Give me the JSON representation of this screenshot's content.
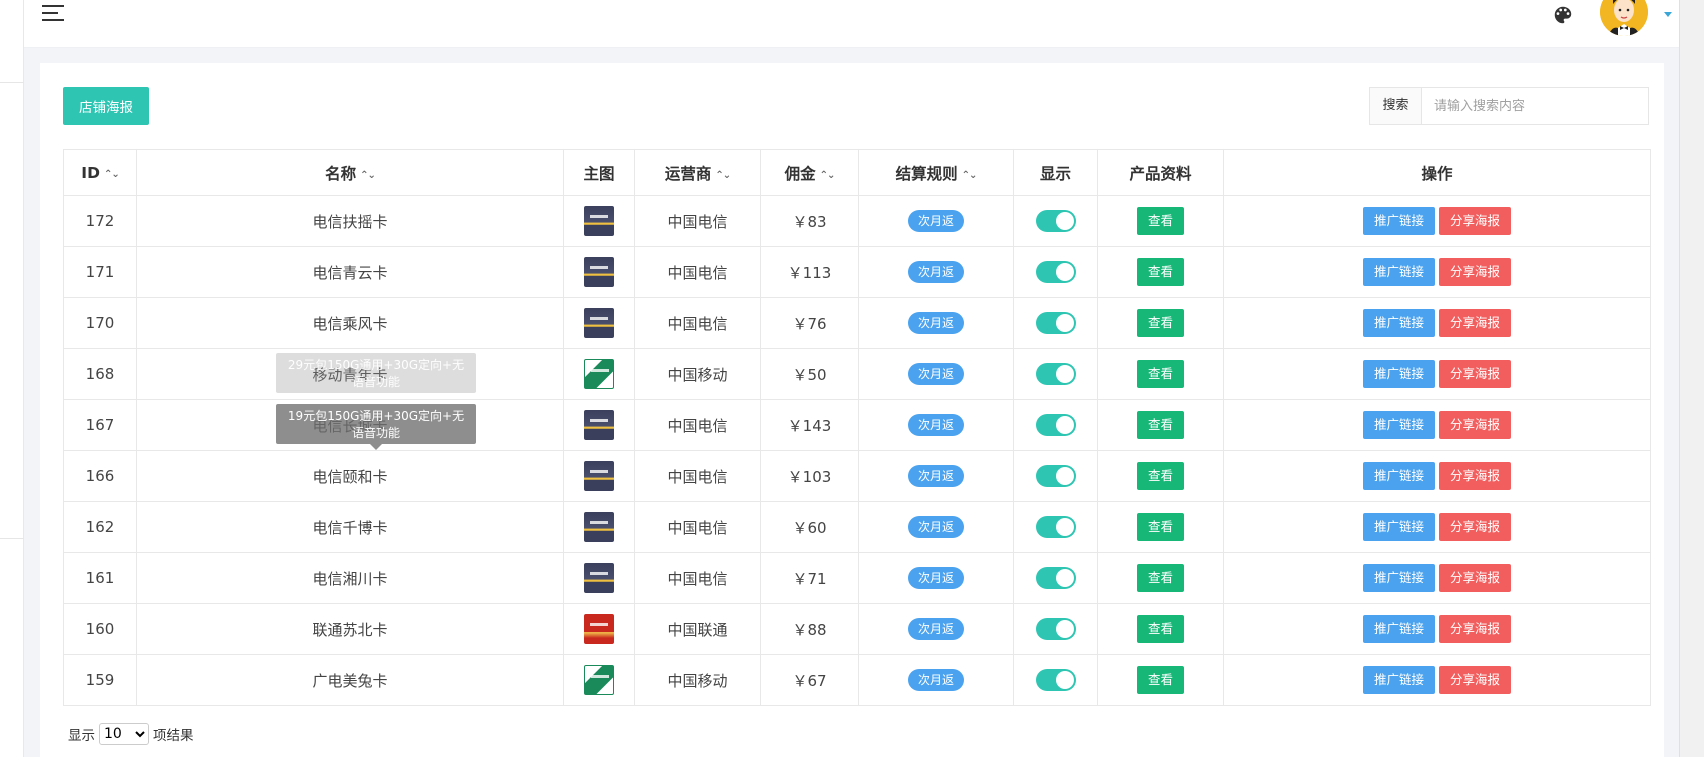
{
  "header": {
    "menu_icon": "hamburger-icon",
    "theme_icon": "palette-icon",
    "avatar_icon": "user-avatar",
    "dropdown_icon": "caret-down-icon",
    "accent_color": "#2ec6b3"
  },
  "toolbar": {
    "poster_button": "店铺海报",
    "search_label": "搜索",
    "search_placeholder": "请输入搜索内容"
  },
  "table": {
    "columns": [
      "ID",
      "名称",
      "主图",
      "运营商",
      "佣金",
      "结算规则",
      "显示",
      "产品资料",
      "操作"
    ],
    "sort_glyph": "⌃⌄",
    "rows": [
      {
        "id": "172",
        "name": "电信扶摇卡",
        "carrier": "中国电信",
        "commission": "￥83",
        "rule": "次月返",
        "thumb": "telecom",
        "shown": true,
        "view": "查看",
        "link": "推广链接",
        "share": "分享海报"
      },
      {
        "id": "171",
        "name": "电信青云卡",
        "carrier": "中国电信",
        "commission": "￥113",
        "rule": "次月返",
        "thumb": "telecom",
        "shown": true,
        "view": "查看",
        "link": "推广链接",
        "share": "分享海报"
      },
      {
        "id": "170",
        "name": "电信乘风卡",
        "carrier": "中国电信",
        "commission": "￥76",
        "rule": "次月返",
        "thumb": "telecom",
        "shown": true,
        "view": "查看",
        "link": "推广链接",
        "share": "分享海报"
      },
      {
        "id": "168",
        "name": "移动青年卡",
        "carrier": "中国移动",
        "commission": "￥50",
        "rule": "次月返",
        "thumb": "mobile",
        "shown": true,
        "view": "查看",
        "link": "推广链接",
        "share": "分享海报"
      },
      {
        "id": "167",
        "name": "电信长城卡",
        "carrier": "中国电信",
        "commission": "￥143",
        "rule": "次月返",
        "thumb": "telecom",
        "shown": true,
        "view": "查看",
        "link": "推广链接",
        "share": "分享海报"
      },
      {
        "id": "166",
        "name": "电信颐和卡",
        "carrier": "中国电信",
        "commission": "￥103",
        "rule": "次月返",
        "thumb": "telecom",
        "shown": true,
        "view": "查看",
        "link": "推广链接",
        "share": "分享海报"
      },
      {
        "id": "162",
        "name": "电信千博卡",
        "carrier": "中国电信",
        "commission": "￥60",
        "rule": "次月返",
        "thumb": "telecom",
        "shown": true,
        "view": "查看",
        "link": "推广链接",
        "share": "分享海报"
      },
      {
        "id": "161",
        "name": "电信湘川卡",
        "carrier": "中国电信",
        "commission": "￥71",
        "rule": "次月返",
        "thumb": "telecom",
        "shown": true,
        "view": "查看",
        "link": "推广链接",
        "share": "分享海报"
      },
      {
        "id": "160",
        "name": "联通苏北卡",
        "carrier": "中国联通",
        "commission": "￥88",
        "rule": "次月返",
        "thumb": "unicom",
        "shown": true,
        "view": "查看",
        "link": "推广链接",
        "share": "分享海报"
      },
      {
        "id": "159",
        "name": "广电美兔卡",
        "carrier": "中国移动",
        "commission": "￥67",
        "rule": "次月返",
        "thumb": "mobile",
        "shown": true,
        "view": "查看",
        "link": "推广链接",
        "share": "分享海报"
      }
    ]
  },
  "tooltips": [
    "29元包150G通用+30G定向+无语音功能",
    "19元包150G通用+30G定向+无语音功能"
  ],
  "pager": {
    "prefix": "显示",
    "page_size": "10",
    "suffix": "项结果"
  }
}
